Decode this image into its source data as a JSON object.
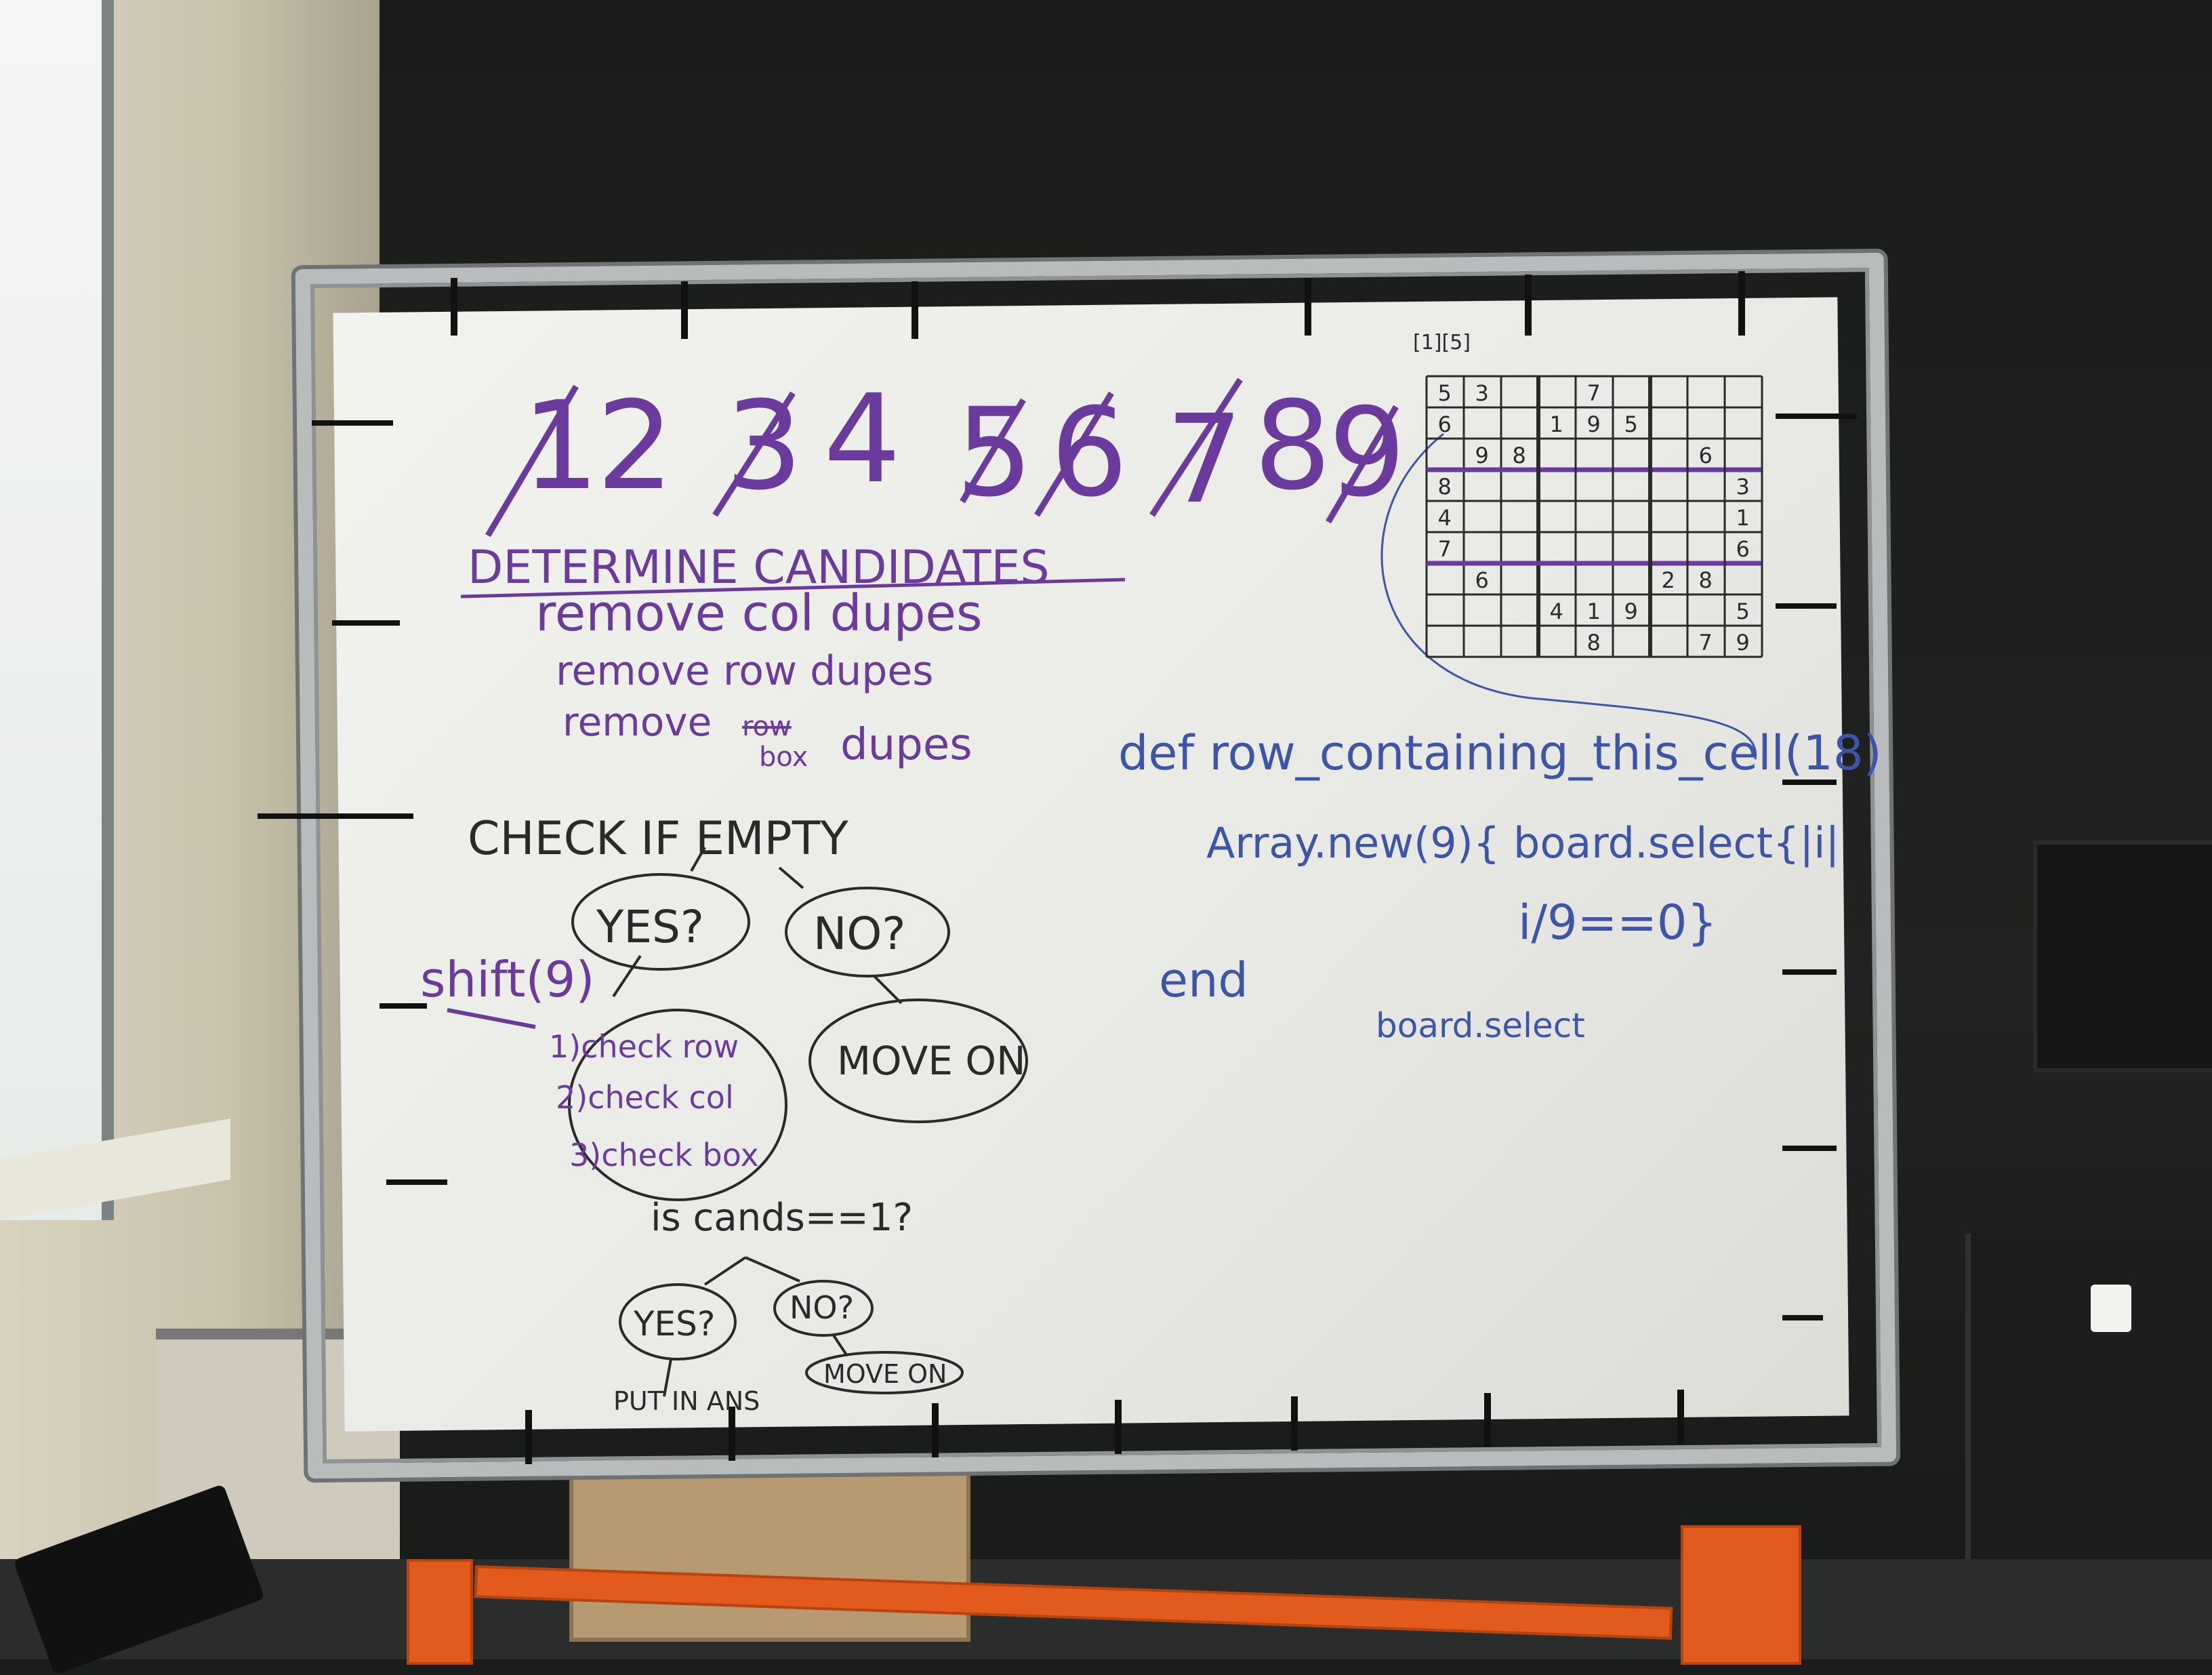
{
  "photo": {
    "colors": {
      "purple_marker": "#6a3b9c",
      "black_marker": "#2a2a2a",
      "blue_marker": "#3d55a8",
      "stand_orange": "#e25a1c",
      "board_white": "#eeeeea"
    },
    "whiteboard": {
      "numbers_row": [
        "1",
        "2",
        "3",
        "4",
        "5",
        "6",
        "7",
        "8",
        "9"
      ],
      "heading": "DETERMINE CANDIDATES",
      "step_col": "remove col dupes",
      "step_row": "remove row dupes",
      "step_box_pre": "remove",
      "step_box_struck": "row",
      "step_box_word": "box",
      "step_box_post": "dupes",
      "check_if_empty": "CHECK IF EMPTY",
      "yes_1": "YES?",
      "no_1": "NO?",
      "move_on_1": "MOVE ON",
      "shift": "shift(9)",
      "check_row": "1)check row",
      "check_col": "2)check col",
      "check_box": "3)check box",
      "is_cands": "is cands==1?",
      "yes_2": "YES?",
      "no_2": "NO?",
      "put_in_ans": "PUT IN ANS",
      "move_on_2": "MOVE ON",
      "def_line": "def row_containing_this_cell(18)",
      "array_line": "Array.new(9){ board.select{|i|",
      "cond_line": "i/9==0}",
      "end_line": "end",
      "board_select": "board.select",
      "grid_label": "[1][5]",
      "sudoku_grid": [
        [
          "5",
          "3",
          "",
          "",
          "7",
          "",
          "",
          "",
          ""
        ],
        [
          "6",
          "",
          "",
          "1",
          "9",
          "5",
          "",
          "",
          ""
        ],
        [
          "",
          "9",
          "8",
          "",
          "",
          "",
          "",
          "6",
          ""
        ],
        [
          "8",
          "",
          "",
          "",
          "",
          "",
          "",
          "",
          "3"
        ],
        [
          "4",
          "",
          "",
          "",
          "",
          "",
          "",
          "",
          "1"
        ],
        [
          "7",
          "",
          "",
          "",
          "",
          "",
          "",
          "",
          "6"
        ],
        [
          "",
          "6",
          "",
          "",
          "",
          "",
          "2",
          "8",
          ""
        ],
        [
          "",
          "",
          "",
          "4",
          "1",
          "9",
          "",
          "",
          "5"
        ],
        [
          "",
          "",
          "",
          "",
          "8",
          "",
          "",
          "7",
          "9"
        ]
      ]
    }
  }
}
